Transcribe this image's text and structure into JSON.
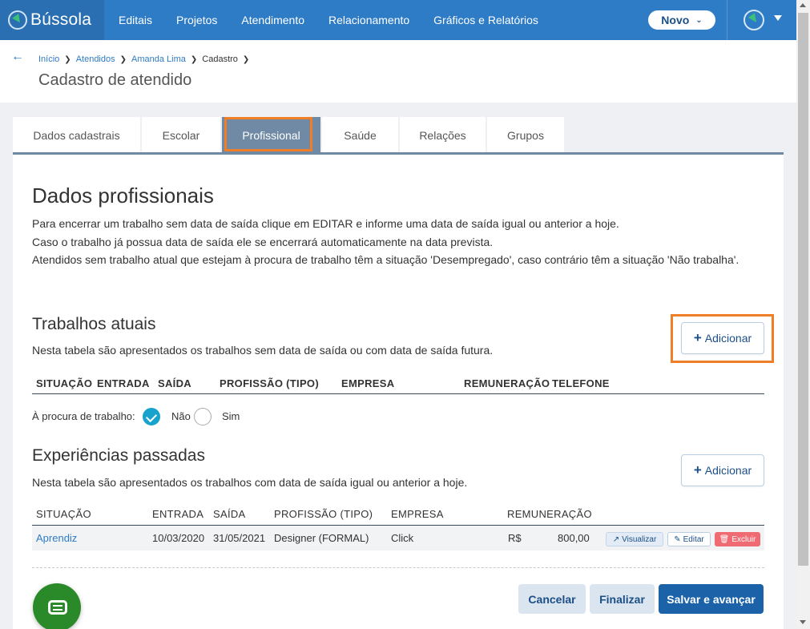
{
  "app": {
    "logo_text": "Bússola",
    "nav": [
      "Editais",
      "Projetos",
      "Atendimento",
      "Relacionamento",
      "Gráficos e Relatórios"
    ],
    "novo_label": "Novo"
  },
  "breadcrumb": {
    "items": [
      "Início",
      "Atendidos",
      "Amanda Lima",
      "Cadastro"
    ]
  },
  "page_title": "Cadastro de atendido",
  "tabs": [
    "Dados cadastrais",
    "Escolar",
    "Profissional",
    "Saúde",
    "Relações",
    "Grupos"
  ],
  "active_tab": "Profissional",
  "section": {
    "title": "Dados profissionais",
    "paragraphs": [
      "Para encerrar um trabalho sem data de saída clique em EDITAR e informe uma data de saída igual ou anterior a hoje.",
      "Caso o trabalho já possua data de saída ele se encerrará automaticamente na data prevista.",
      "Atendidos sem trabalho atual que estejam à procura de trabalho têm a situação 'Desempregado', caso contrário têm a situação 'Não trabalha'."
    ]
  },
  "current_jobs": {
    "title": "Trabalhos atuais",
    "subtitle": "Nesta tabela são apresentados os trabalhos sem data de saída ou com data de saída futura.",
    "add_label": "Adicionar",
    "columns": [
      "SITUAÇÃO",
      "ENTRADA",
      "SAÍDA",
      "PROFISSÃO (TIPO)",
      "EMPRESA",
      "REMUNERAÇÃO",
      "TELEFONE"
    ],
    "looking_label": "À procura de trabalho:",
    "option_no": "Não",
    "option_yes": "Sim",
    "selected": "Não"
  },
  "past_jobs": {
    "title": "Experiências passadas",
    "subtitle": "Nesta tabela são apresentados os trabalhos com data de saída igual ou anterior a hoje.",
    "add_label": "Adicionar",
    "columns": [
      "SITUAÇÃO",
      "ENTRADA",
      "SAÍDA",
      "PROFISSÃO (TIPO)",
      "EMPRESA",
      "REMUNERAÇÃO"
    ],
    "rows": [
      {
        "situacao": "Aprendiz",
        "entrada": "10/03/2020",
        "saida": "31/05/2021",
        "profissao": "Designer (FORMAL)",
        "empresa": "Click",
        "moeda": "R$",
        "valor": "800,00"
      }
    ],
    "row_actions": [
      "Visualizar",
      "Editar",
      "Excluir"
    ]
  },
  "footer_buttons": {
    "cancel": "Cancelar",
    "finish": "Finalizar",
    "save_next": "Salvar e avançar"
  },
  "icons": {
    "logo": "compass-icon",
    "chat": "chat-icon",
    "user": "user-compass-icon"
  },
  "colors": {
    "nav_bg": "#2e7bc6",
    "active_tab": "#708aa6",
    "highlight": "#f07e26",
    "primary_button": "#1b62a8",
    "delete_button": "#ef6a72",
    "radio_checked": "#18a3cc"
  }
}
